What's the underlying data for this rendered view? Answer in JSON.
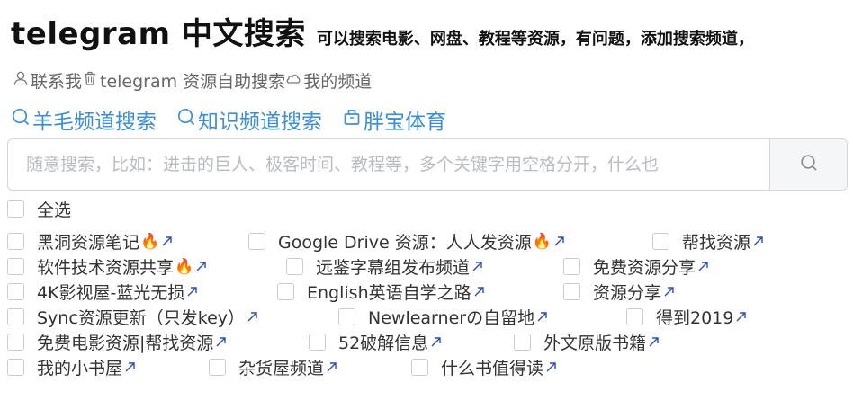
{
  "header": {
    "title": "telegram 中文搜索",
    "subtitle": "可以搜索电影、网盘、教程等资源，有问题，添加搜索频道，"
  },
  "top_links": [
    {
      "icon": "user-icon",
      "label": "联系我"
    },
    {
      "icon": "trash-icon",
      "label": "telegram 资源自助搜索"
    },
    {
      "icon": "cloud-icon",
      "label": "我的频道"
    }
  ],
  "channel_links": [
    {
      "icon": "search-icon",
      "label": "羊毛频道搜索"
    },
    {
      "icon": "search-icon",
      "label": "知识频道搜索"
    },
    {
      "icon": "bag-icon",
      "label": "胖宝体育"
    }
  ],
  "search": {
    "placeholder": "随意搜索，比如：进击的巨人、极客时间、教程等，多个关键字用空格分开，什么也",
    "value": ""
  },
  "select_all_label": "全选",
  "channel_rows": [
    [
      {
        "label": "黑洞资源笔记",
        "hot": true,
        "checked": false
      },
      {
        "label": "Google Drive 资源：人人发资源",
        "hot": true,
        "checked": false
      },
      {
        "label": "帮找资源",
        "hot": false,
        "checked": false
      }
    ],
    [
      {
        "label": "软件技术资源共享",
        "hot": true,
        "checked": false
      },
      {
        "label": "远鉴字幕组发布频道",
        "hot": false,
        "checked": false
      },
      {
        "label": "免费资源分享",
        "hot": false,
        "checked": false
      }
    ],
    [
      {
        "label": "4K影视屋-蓝光无损",
        "hot": false,
        "checked": false
      },
      {
        "label": "English英语自学之路",
        "hot": false,
        "checked": false
      },
      {
        "label": "资源分享",
        "hot": false,
        "checked": false
      }
    ],
    [
      {
        "label": "Sync资源更新（只发key）",
        "hot": false,
        "checked": false
      },
      {
        "label": "Newlearnerの自留地",
        "hot": false,
        "checked": false
      },
      {
        "label": "得到2019",
        "hot": false,
        "checked": false
      }
    ],
    [
      {
        "label": "免费电影资源|帮找资源",
        "hot": false,
        "checked": false
      },
      {
        "label": "52破解信息",
        "hot": false,
        "checked": false
      },
      {
        "label": "外文原版书籍",
        "hot": false,
        "checked": false
      }
    ],
    [
      {
        "label": "我的小书屋",
        "hot": false,
        "checked": false
      },
      {
        "label": "杂货屋频道",
        "hot": false,
        "checked": false
      },
      {
        "label": "什么书值得读",
        "hot": false,
        "checked": false
      }
    ]
  ],
  "colors": {
    "link_blue": "#3d8ed8",
    "arrow_blue": "#2b4bb8",
    "muted": "#666666"
  }
}
